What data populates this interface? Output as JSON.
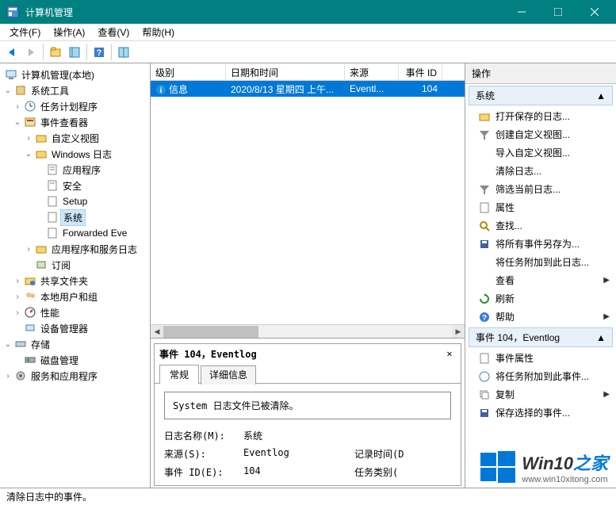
{
  "window": {
    "title": "计算机管理"
  },
  "menu": {
    "file": "文件(F)",
    "action": "操作(A)",
    "view": "查看(V)",
    "help": "帮助(H)"
  },
  "tree": {
    "root": "计算机管理(本地)",
    "system_tools": "系统工具",
    "task_scheduler": "任务计划程序",
    "event_viewer": "事件查看器",
    "custom_views": "自定义视图",
    "windows_logs": "Windows 日志",
    "application": "应用程序",
    "security": "安全",
    "setup": "Setup",
    "system": "系统",
    "forwarded": "Forwarded Eve",
    "app_service_logs": "应用程序和服务日志",
    "subscriptions": "订阅",
    "shared_folders": "共享文件夹",
    "local_users": "本地用户和组",
    "performance": "性能",
    "device_manager": "设备管理器",
    "storage": "存储",
    "disk_management": "磁盘管理",
    "services_apps": "服务和应用程序"
  },
  "table": {
    "headers": {
      "level": "级别",
      "datetime": "日期和时间",
      "source": "来源",
      "event_id": "事件 ID",
      "task_category": ""
    },
    "widths": {
      "level": 95,
      "datetime": 150,
      "source": 68,
      "event_id": 55
    },
    "rows": [
      {
        "level": "信息",
        "datetime": "2020/8/13 星期四 上午...",
        "source": "Eventl...",
        "event_id": "104"
      }
    ]
  },
  "detail": {
    "title": "事件 104，Eventlog",
    "tab_general": "常规",
    "tab_details": "详细信息",
    "message": "System 日志文件已被清除。",
    "labels": {
      "log_name": "日志名称(M):",
      "source": "来源(S):",
      "event_id": "事件 ID(E):",
      "logged": "记录时间(D",
      "task_category": "任务类别("
    },
    "values": {
      "log_name": "系统",
      "source": "Eventlog",
      "event_id": "104"
    }
  },
  "actions": {
    "header": "操作",
    "section1": "系统",
    "items1": [
      "打开保存的日志...",
      "创建自定义视图...",
      "导入自定义视图...",
      "清除日志...",
      "筛选当前日志...",
      "属性",
      "查找...",
      "将所有事件另存为...",
      "将任务附加到此日志...",
      "查看",
      "刷新",
      "帮助"
    ],
    "section2": "事件 104，Eventlog",
    "items2": [
      "事件属性",
      "将任务附加到此事件...",
      "复制",
      "保存选择的事件..."
    ]
  },
  "statusbar": {
    "text": "清除日志中的事件。"
  },
  "watermark": {
    "brand1": "Win10",
    "brand2": "之家",
    "url": "www.win10xitong.com"
  }
}
